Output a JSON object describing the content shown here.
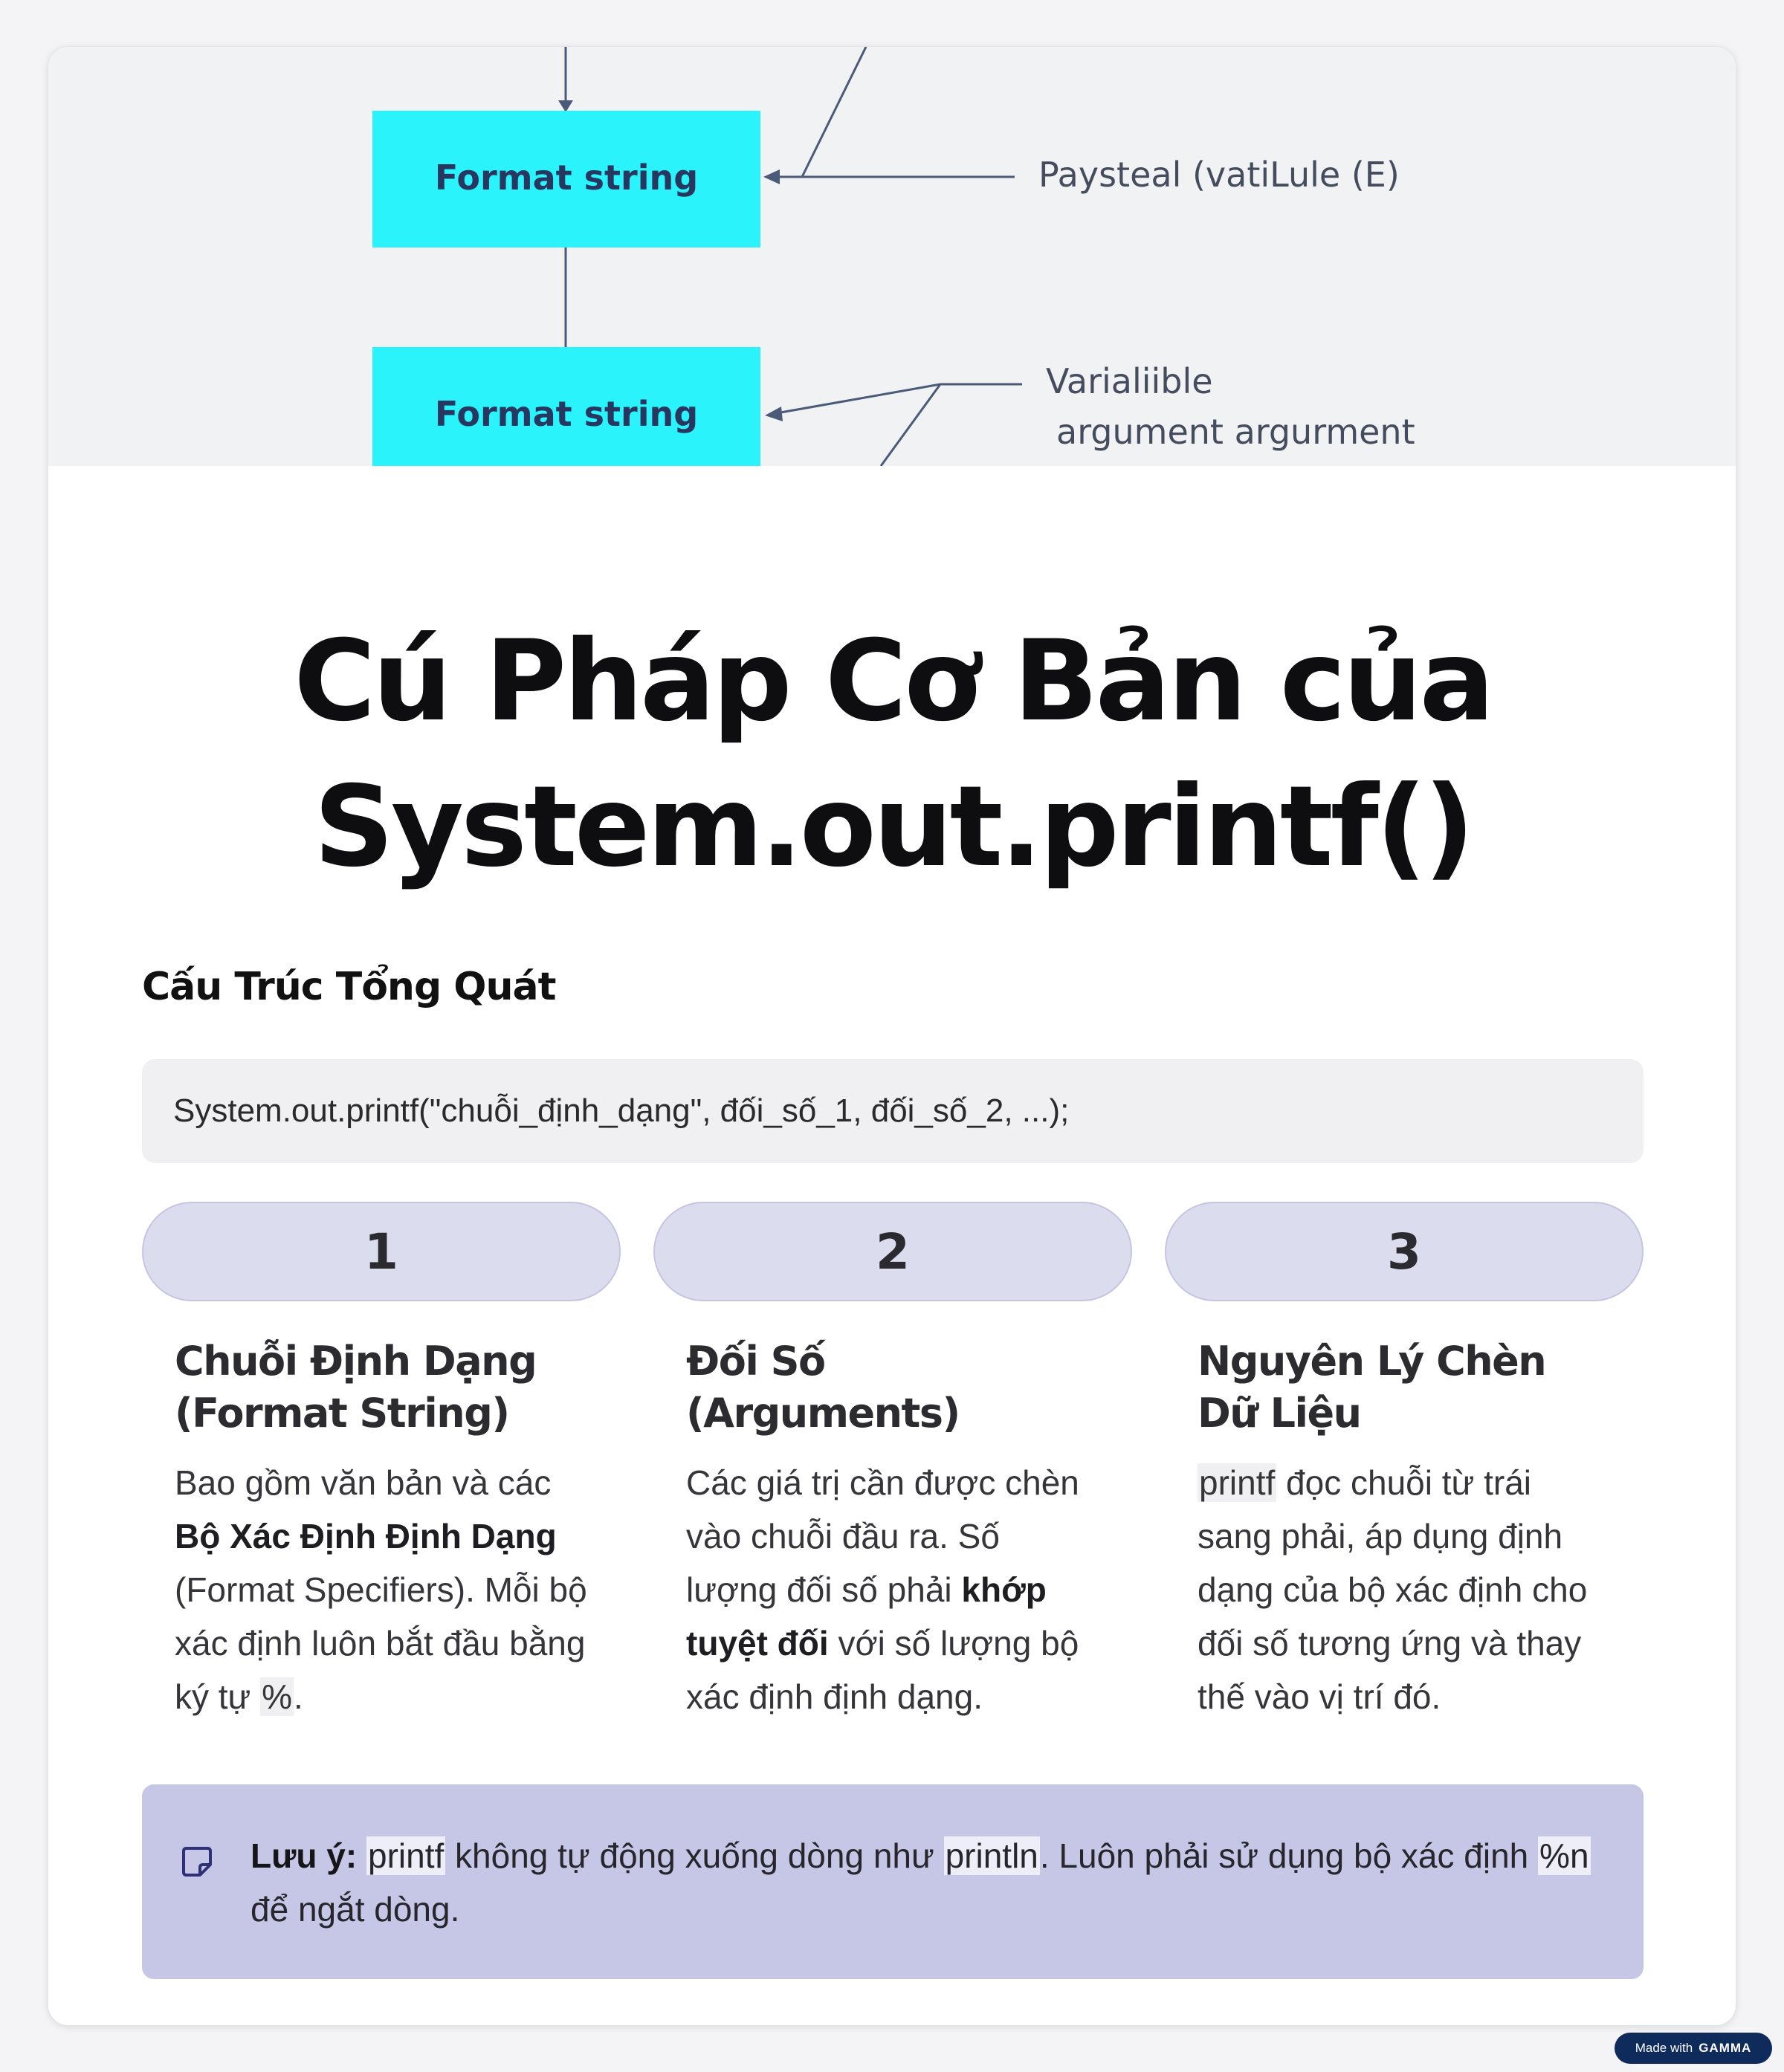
{
  "hero": {
    "box1_label": "Format string",
    "box2_label": "Format string",
    "arrow1_label": "Paysteal (vatiLule (E)",
    "arrow2_label_line1": "Varialiible",
    "arrow2_label_line2": "argument argurment"
  },
  "title_line1": "Cú Pháp Cơ Bản của",
  "title_line2": "System.out.printf()",
  "section_heading": "Cấu Trúc Tổng Quát",
  "code_example": "System.out.printf(\"chuỗi_định_dạng\", đối_số_1, đối_số_2, ...);",
  "steps": [
    {
      "number": "1",
      "title": "Chuỗi Định Dạng (Format String)",
      "text_a": "Bao gồm văn bản và các ",
      "text_bold": "Bộ Xác Định Định Dạng",
      "text_b": " (Format Specifiers). Mỗi bộ xác định luôn bắt đầu bằng ký tự ",
      "text_code": "%",
      "text_c": "."
    },
    {
      "number": "2",
      "title": "Đối Số (Arguments)",
      "text_a": "Các giá trị cần được chèn vào chuỗi đầu ra. Số lượng đối số phải ",
      "text_bold": "khớp tuyệt đối",
      "text_b": " với số lượng bộ xác định định dạng."
    },
    {
      "number": "3",
      "title": "Nguyên Lý Chèn Dữ Liệu",
      "text_code": "printf",
      "text_a": " đọc chuỗi từ trái sang phải, áp dụng định dạng của bộ xác định cho đối số tương ứng và thay thế vào vị trí đó."
    }
  ],
  "note": {
    "label": "Lưu ý:",
    "code1": "printf",
    "text1": " không tự động xuống dòng như ",
    "code2": "println",
    "text2": ". Luôn phải sử dụng bộ xác định ",
    "code3": "%n",
    "text3": " để ngắt dòng."
  },
  "badge": {
    "made_with": "Made with",
    "brand": "GAMMA"
  },
  "colors": {
    "hero_box": "#2af3fb",
    "pill_bg": "#dcdcef",
    "note_bg": "#c6c7e7",
    "badge_bg": "#0f2b5b"
  }
}
